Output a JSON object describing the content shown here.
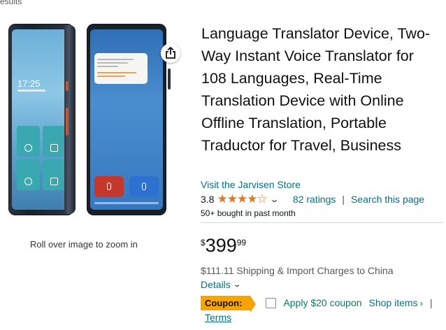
{
  "breadcrumb": {
    "fragment": "esults"
  },
  "image": {
    "zoom_hint": "Roll over image to zoom in",
    "share_icon": "share-icon",
    "device_left": {
      "time": "17:25"
    }
  },
  "product": {
    "title": "Language Translator Device, Two-Way Instant Voice Translator for 108 Languages, Real-Time Translation Device with Online Offline Translation, Portable Traductor for Travel, Business",
    "store_link": "Visit the Jarvisen Store",
    "rating_value": "3.8",
    "rating_stars": 3.8,
    "stars_glyphs": "★★★★☆",
    "ratings_count": "82 ratings",
    "separator": "|",
    "search_page": "Search this page",
    "bought": "50+ bought in past month"
  },
  "price": {
    "symbol": "$",
    "whole": "399",
    "fraction": "99"
  },
  "shipping": {
    "text": "$111.11 Shipping & Import Charges to China",
    "details": "Details"
  },
  "coupon": {
    "badge": "Coupon:",
    "apply": "Apply $20 coupon",
    "shop_items": "Shop items",
    "shop_chevron": "›",
    "pipe": "|",
    "terms": "Terms"
  },
  "colors": {
    "link": "#007185",
    "star": "#de7921",
    "coupon_badge": "#f7a400",
    "coupon_apply": "#067d62"
  }
}
